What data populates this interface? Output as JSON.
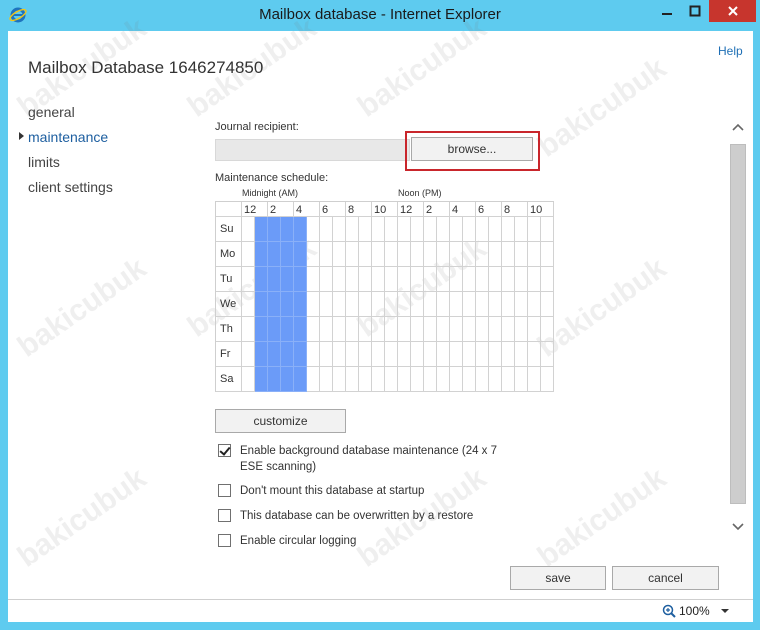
{
  "window": {
    "title": "Mailbox database - Internet Explorer",
    "controls": [
      "minimize",
      "maximize",
      "close"
    ]
  },
  "help_link": "Help",
  "page_title": "Mailbox Database 1646274850",
  "nav": {
    "items": [
      {
        "label": "general",
        "active": false
      },
      {
        "label": "maintenance",
        "active": true
      },
      {
        "label": "limits",
        "active": false
      },
      {
        "label": "client settings",
        "active": false
      }
    ]
  },
  "journal": {
    "label": "Journal recipient:",
    "value": "",
    "browse_label": "browse..."
  },
  "schedule": {
    "label": "Maintenance schedule:",
    "midnight_caption": "Midnight (AM)",
    "noon_caption": "Noon (PM)",
    "hour_labels": [
      "12",
      "2",
      "4",
      "6",
      "8",
      "10",
      "12",
      "2",
      "4",
      "6",
      "8",
      "10"
    ],
    "days": [
      "Su",
      "Mo",
      "Tu",
      "We",
      "Th",
      "Fr",
      "Sa"
    ],
    "selected_hours": [
      1,
      2,
      3,
      4
    ]
  },
  "customize_label": "customize",
  "options": [
    {
      "label": "Enable background database maintenance (24 x 7 ESE scanning)",
      "checked": true
    },
    {
      "label": "Don't mount this database at startup",
      "checked": false
    },
    {
      "label": "This database can be overwritten by a restore",
      "checked": false
    },
    {
      "label": "Enable circular logging",
      "checked": false
    }
  ],
  "footer": {
    "save_label": "save",
    "cancel_label": "cancel"
  },
  "status": {
    "zoom": "100%"
  },
  "colors": {
    "titlebar": "#5ecbef",
    "schedule_selected": "#6b9bf8",
    "highlight_box": "#c9262c",
    "link": "#1e6fb5"
  }
}
